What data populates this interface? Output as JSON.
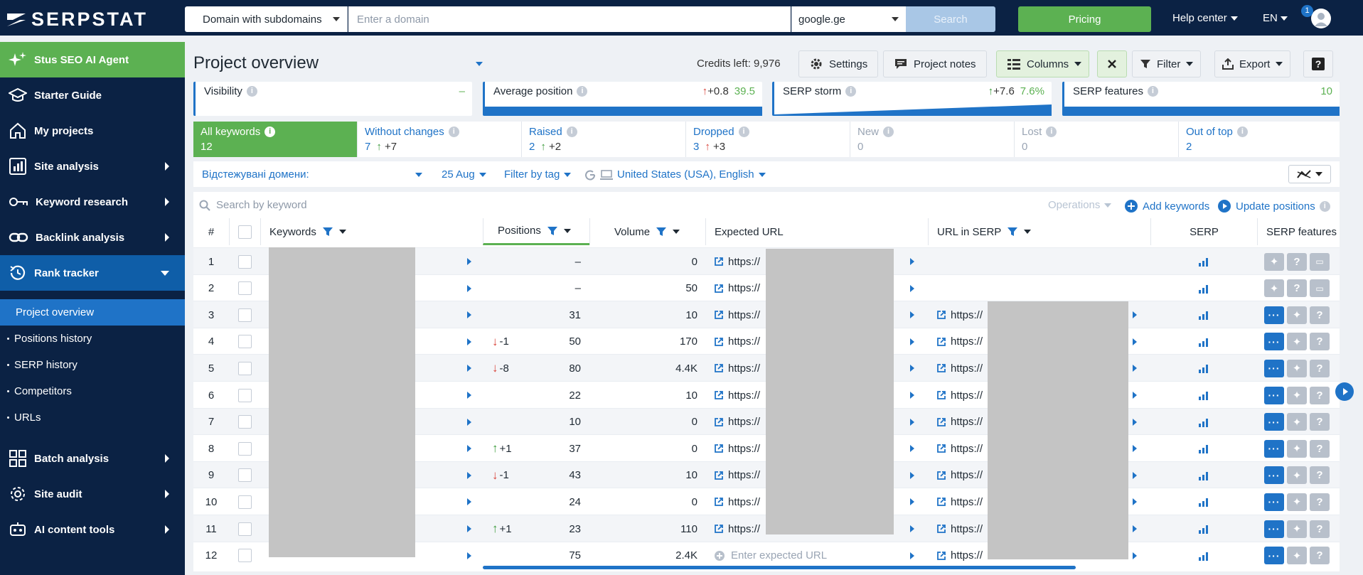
{
  "topbar": {
    "logo": "SERPSTAT",
    "domain_mode": "Domain with subdomains",
    "domain_placeholder": "Enter a domain",
    "engine": "google.ge",
    "search": "Search",
    "pricing": "Pricing",
    "help": "Help center",
    "lang": "EN",
    "notifications": "1"
  },
  "sidebar": {
    "items": [
      {
        "label": "Stus SEO AI Agent",
        "icon": "sparkle-icon"
      },
      {
        "label": "Starter Guide",
        "icon": "graduation-cap-icon"
      },
      {
        "label": "My projects",
        "icon": "home-icon"
      },
      {
        "label": "Site analysis",
        "icon": "bar-chart-icon"
      },
      {
        "label": "Keyword research",
        "icon": "key-icon"
      },
      {
        "label": "Backlink analysis",
        "icon": "link-icon"
      },
      {
        "label": "Rank tracker",
        "icon": "history-icon"
      },
      {
        "label": "Batch analysis",
        "icon": "grid-icon"
      },
      {
        "label": "Site audit",
        "icon": "gear-icon"
      },
      {
        "label": "AI content tools",
        "icon": "robot-icon"
      }
    ],
    "sub_items": [
      "Project overview",
      "Positions history",
      "SERP history",
      "Competitors",
      "URLs"
    ]
  },
  "header": {
    "title": "Project overview",
    "credits": "Credits left: 9,976",
    "settings": "Settings",
    "notes": "Project notes",
    "columns": "Columns",
    "filter": "Filter",
    "export": "Export",
    "help": "?"
  },
  "metrics": [
    {
      "label": "Visibility",
      "change": "",
      "value": "–"
    },
    {
      "label": "Average position",
      "change": "+0.8",
      "value": "39.5"
    },
    {
      "label": "SERP storm",
      "change": "+7.6",
      "value": "7.6%"
    },
    {
      "label": "SERP features",
      "change": "",
      "value": "10"
    }
  ],
  "tabs": [
    {
      "label": "All keywords",
      "count": "12",
      "delta": ""
    },
    {
      "label": "Without changes",
      "count": "7",
      "delta": "+7"
    },
    {
      "label": "Raised",
      "count": "2",
      "delta": "+2"
    },
    {
      "label": "Dropped",
      "count": "3",
      "delta": "+3"
    },
    {
      "label": "New",
      "count": "0",
      "delta": ""
    },
    {
      "label": "Lost",
      "count": "0",
      "delta": ""
    },
    {
      "label": "Out of top",
      "count": "2",
      "delta": ""
    }
  ],
  "filters": {
    "domains": "Відстежувані домени:",
    "date": "25 Aug",
    "tag": "Filter by tag",
    "region": "United States (USA), English"
  },
  "table": {
    "search_placeholder": "Search by keyword",
    "operations": "Operations",
    "add_keywords": "Add keywords",
    "update_positions": "Update positions",
    "headers": [
      "#",
      "Keywords",
      "Positions",
      "Volume",
      "Expected URL",
      "URL in SERP",
      "SERP",
      "SERP features"
    ],
    "url_prefix": "https://",
    "expected_placeholder": "Enter expected URL",
    "rows": [
      {
        "n": "1",
        "change": "",
        "dir": "",
        "position": "–",
        "volume": "0",
        "expected": true,
        "serp_url": false
      },
      {
        "n": "2",
        "change": "",
        "dir": "",
        "position": "–",
        "volume": "50",
        "expected": true,
        "serp_url": false
      },
      {
        "n": "3",
        "change": "",
        "dir": "",
        "position": "31",
        "volume": "10",
        "expected": true,
        "serp_url": true
      },
      {
        "n": "4",
        "change": "-1",
        "dir": "down",
        "position": "50",
        "volume": "170",
        "expected": true,
        "serp_url": true
      },
      {
        "n": "5",
        "change": "-8",
        "dir": "down",
        "position": "80",
        "volume": "4.4K",
        "expected": true,
        "serp_url": true
      },
      {
        "n": "6",
        "change": "",
        "dir": "",
        "position": "22",
        "volume": "10",
        "expected": true,
        "serp_url": true
      },
      {
        "n": "7",
        "change": "",
        "dir": "",
        "position": "10",
        "volume": "0",
        "expected": true,
        "serp_url": true
      },
      {
        "n": "8",
        "change": "+1",
        "dir": "up",
        "position": "37",
        "volume": "0",
        "expected": true,
        "serp_url": true
      },
      {
        "n": "9",
        "change": "-1",
        "dir": "down",
        "position": "43",
        "volume": "10",
        "expected": true,
        "serp_url": true
      },
      {
        "n": "10",
        "change": "",
        "dir": "",
        "position": "24",
        "volume": "0",
        "expected": true,
        "serp_url": true
      },
      {
        "n": "11",
        "change": "+1",
        "dir": "up",
        "position": "23",
        "volume": "110",
        "expected": true,
        "serp_url": true
      },
      {
        "n": "12",
        "change": "",
        "dir": "",
        "position": "75",
        "volume": "2.4K",
        "expected": false,
        "serp_url": true
      }
    ]
  },
  "colors": {
    "navy": "#0b2244",
    "green": "#5cb152",
    "blue": "#1f73c7",
    "up": "#3c9b3c",
    "down": "#d9443b"
  }
}
